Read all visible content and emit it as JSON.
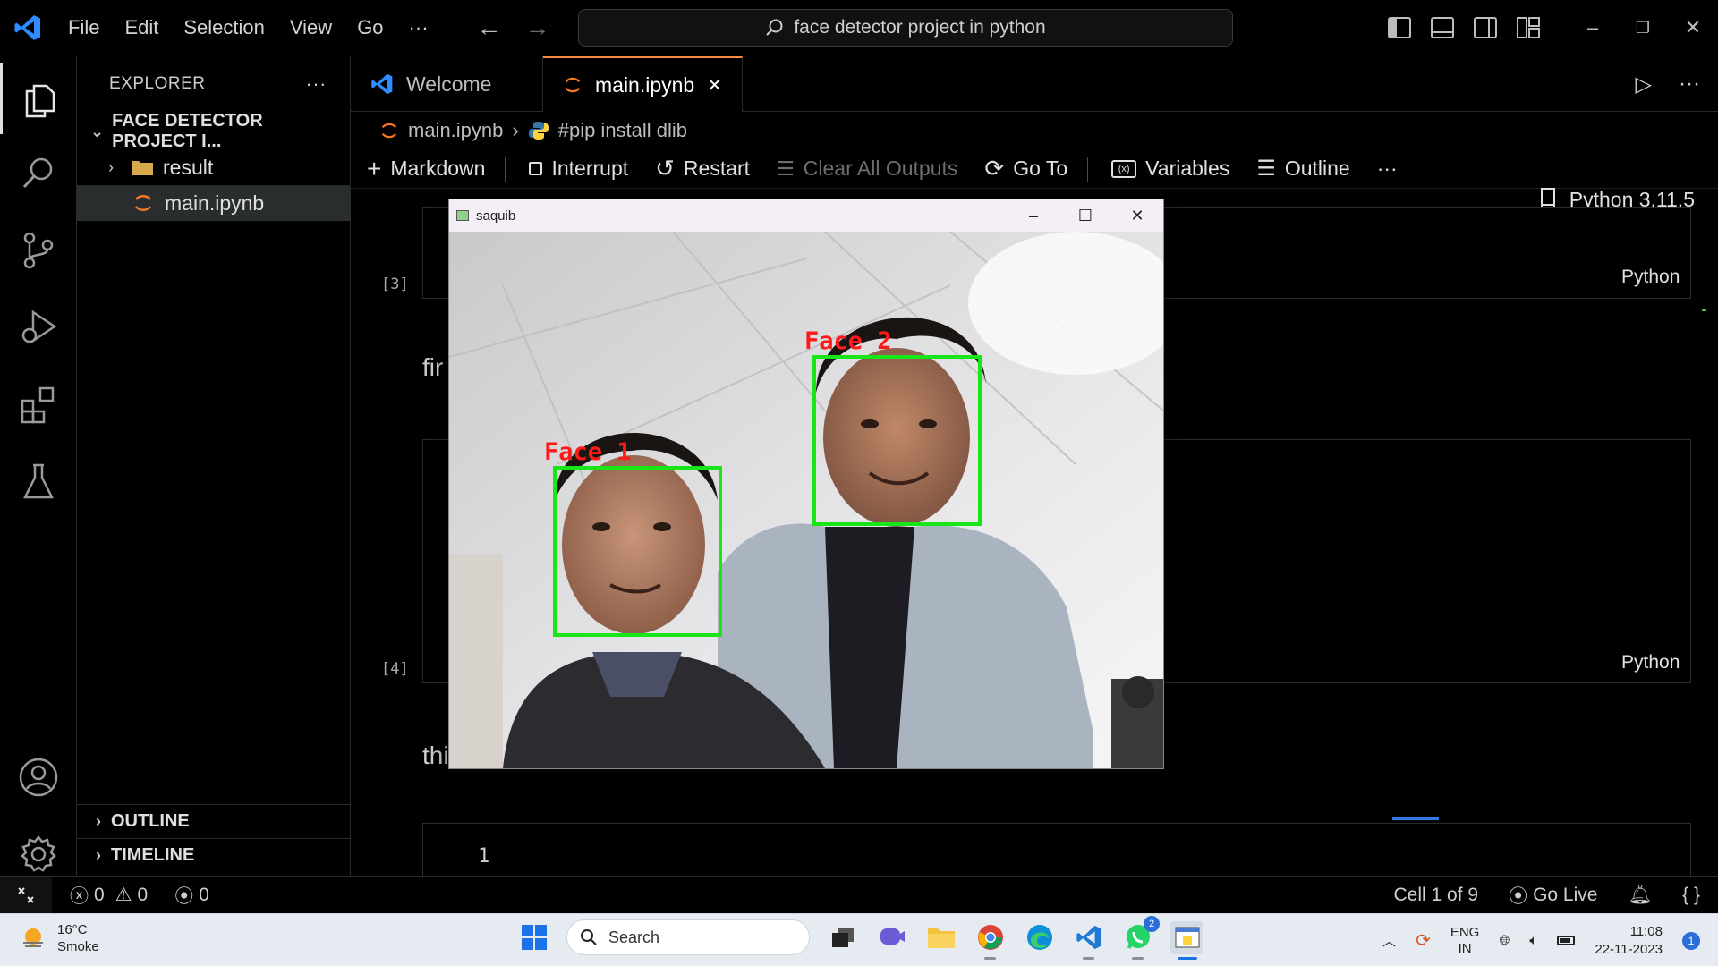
{
  "menu": [
    "File",
    "Edit",
    "Selection",
    "View",
    "Go",
    "···"
  ],
  "search": {
    "text": "face detector project in python"
  },
  "explorer": {
    "title": "EXPLORER",
    "more": "···",
    "root": "FACE DETECTOR PROJECT I...",
    "items": [
      {
        "label": "result",
        "type": "folder"
      },
      {
        "label": "main.ipynb",
        "type": "notebook",
        "selected": true
      }
    ],
    "sections": [
      "OUTLINE",
      "TIMELINE"
    ]
  },
  "tabs": [
    {
      "label": "Welcome"
    },
    {
      "label": "main.ipynb",
      "active": true,
      "close": "✕"
    }
  ],
  "tab_more": "···",
  "breadcrumb": {
    "file": "main.ipynb",
    "symbol": "#pip install dlib"
  },
  "toolbar": {
    "markdown": "Markdown",
    "interrupt": "Interrupt",
    "restart": "Restart",
    "clear": "Clear All Outputs",
    "goto": "Go To",
    "variables": "Variables",
    "outline": "Outline",
    "more": "···"
  },
  "kernel": "Python 3.11.5",
  "cells": [
    {
      "count": "[3]",
      "lang": "Python"
    },
    {
      "count": "[4]",
      "lang": "Python"
    }
  ],
  "md_fragments": [
    "fir",
    "thi"
  ],
  "last_cell_line": "1",
  "image_window": {
    "title": "saquib",
    "faces": [
      "Face 1",
      "Face 2"
    ],
    "box_color": "#19e619",
    "label_color": "#ff1a1a"
  },
  "status": {
    "errors": "0",
    "warnings": "0",
    "ports": "0",
    "cell": "Cell 1 of 9",
    "golive": "Go Live"
  },
  "taskbar": {
    "temp": "16°C",
    "weather": "Smoke",
    "search": "Search",
    "whatsapp_badge": "2",
    "lang1": "ENG",
    "lang2": "IN",
    "time": "11:08",
    "date": "22-11-2023",
    "notif": "1"
  },
  "colors": {
    "accent_tab": "#ff8a3d",
    "vscode_blue": "#2f8bff"
  }
}
